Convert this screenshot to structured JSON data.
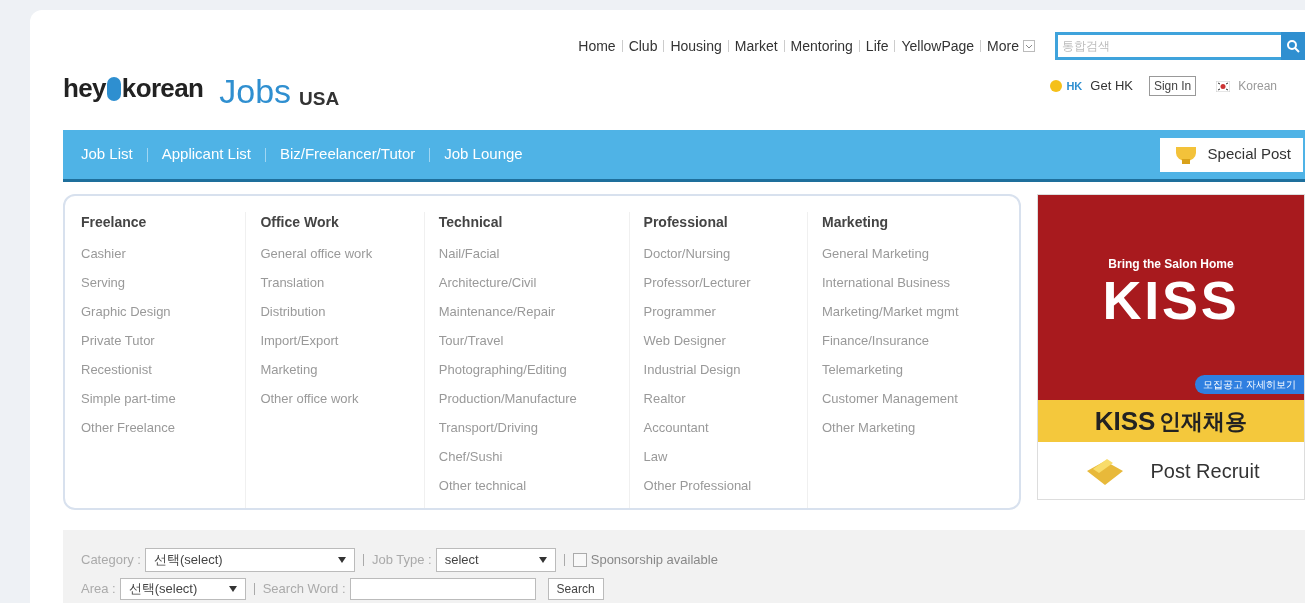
{
  "logo": {
    "brand_left": "hey",
    "brand_right": "korean",
    "section": "Jobs",
    "region": "USA"
  },
  "top_nav": [
    "Home",
    "Club",
    "Housing",
    "Market",
    "Mentoring",
    "Life",
    "YellowPage",
    "More"
  ],
  "search": {
    "placeholder": "통합검색"
  },
  "account": {
    "points_label": "HK",
    "get_points": "Get HK",
    "sign_in": "Sign In",
    "language": "Korean"
  },
  "main_nav": {
    "items": [
      "Job List",
      "Applicant List",
      "Biz/Freelancer/Tutor",
      "Job Lounge"
    ],
    "special_post": "Special Post"
  },
  "categories": [
    {
      "title": "Freelance",
      "items": [
        "Cashier",
        "Serving",
        "Graphic Design",
        "Private Tutor",
        "Recestionist",
        "Simple part-time",
        "Other Freelance"
      ]
    },
    {
      "title": "Office Work",
      "items": [
        "General office work",
        "Translation",
        "Distribution",
        "Import/Export",
        "Marketing",
        "Other office work"
      ]
    },
    {
      "title": "Technical",
      "items": [
        "Nail/Facial",
        "Architecture/Civil",
        "Maintenance/Repair",
        "Tour/Travel",
        "Photographing/Editing",
        "Production/Manufacture",
        "Transport/Driving",
        "Chef/Sushi",
        "Other technical"
      ]
    },
    {
      "title": "Professional",
      "items": [
        "Doctor/Nursing",
        "Professor/Lecturer",
        "Programmer",
        "Web Designer",
        "Industrial Design",
        "Realtor",
        "Accountant",
        "Law",
        "Other Professional"
      ]
    },
    {
      "title": "Marketing",
      "items": [
        "General Marketing",
        "International Business",
        "Marketing/Market mgmt",
        "Finance/Insurance",
        "Telemarketing",
        "Customer Management",
        "Other Marketing"
      ]
    }
  ],
  "ad": {
    "tagline": "Bring the Salon Home",
    "brand": "KISS",
    "badge": "모집공고 자세히보기",
    "recruit_brand": "KISS",
    "recruit_label": "인재채용",
    "post_recruit": "Post Recruit"
  },
  "filters": {
    "category_label": "Category :",
    "category_value": "선택(select)",
    "job_type_label": "Job Type :",
    "job_type_value": "select",
    "sponsorship": {
      "label": "Sponsorship available",
      "checked": false
    },
    "area_label": "Area :",
    "area_value": "선택(select)",
    "search_word_label": "Search Word :",
    "search_button": "Search"
  }
}
